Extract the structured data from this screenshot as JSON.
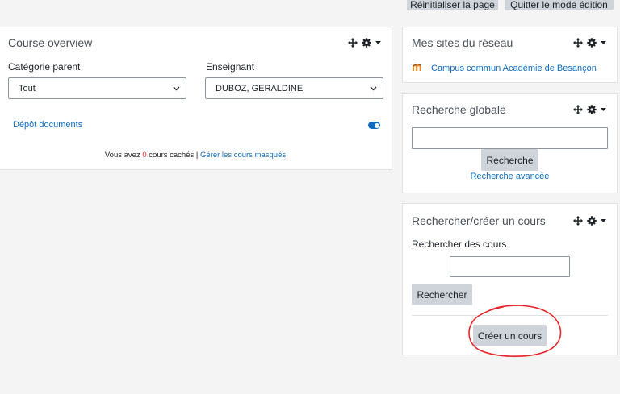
{
  "top_bar": {
    "reset_label": "Réinitialiser la page",
    "quit_edit_label": "Quitter le mode édition"
  },
  "course_overview": {
    "title": "Course overview",
    "category_label": "Catégorie parent",
    "category_value": "Tout",
    "teacher_label": "Enseignant",
    "teacher_value": "DUBOZ, GERALDINE",
    "course_link": "Dépôt documents",
    "hidden_prefix": "Vous avez ",
    "hidden_count": "0",
    "hidden_suffix": " cours cachés | ",
    "manage_hidden_link": "Gérer les cours masqués"
  },
  "network_sites": {
    "title": "Mes sites du réseau",
    "items": [
      {
        "label": "Campus commun Académie de Besançon",
        "icon": "moodle-logo-icon"
      }
    ]
  },
  "global_search": {
    "title": "Recherche globale",
    "input_value": "",
    "search_button": "Recherche",
    "advanced_link": "Recherche avancée"
  },
  "course_search": {
    "title": "Rechercher/créer un cours",
    "search_label": "Rechercher des cours",
    "input_value": "",
    "search_button": "Rechercher",
    "create_button": "Créer un cours"
  },
  "colors": {
    "accent": "#0f6cbf",
    "annotation": "#e8262a",
    "hidden_count": "#e8262a",
    "moodle_orange": "#f98012"
  }
}
